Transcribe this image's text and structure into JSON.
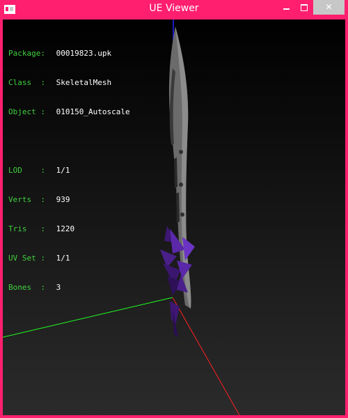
{
  "window": {
    "title": "UE Viewer",
    "minimize_label": "",
    "maximize_label": "",
    "close_label": "✕"
  },
  "info": {
    "package_key": "Package:",
    "package_val": "00019823.upk",
    "class_key": "Class  :",
    "class_val": "SkeletalMesh",
    "object_key": "Object :",
    "object_val": "010150_Autoscale",
    "lod_key": "LOD    :",
    "lod_val": "1/1",
    "verts_key": "Verts  :",
    "verts_val": "939",
    "tris_key": "Tris   :",
    "tris_val": "1220",
    "uvset_key": "UV Set :",
    "uvset_val": "1/1",
    "bones_key": "Bones  :",
    "bones_val": "3"
  },
  "colors": {
    "frame": "#ff1f6e",
    "axis_x": "#ff2020",
    "axis_y": "#20ff20",
    "axis_z": "#2020ff",
    "blade": "#6e6e6e",
    "crystal": "#4a1f8a"
  }
}
